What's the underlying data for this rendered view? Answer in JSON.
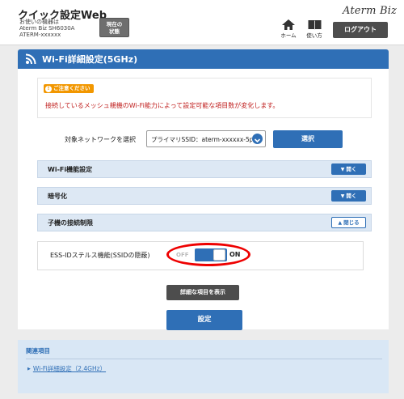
{
  "header": {
    "app_title": "クイック設定Web",
    "device_caption": "お使いの機器は",
    "device_model": "Aterm Biz SH6030A",
    "device_id": "ATERM-xxxxxx",
    "status_button": "現在の\n状態",
    "brand": "Aterm Biz",
    "nav_home": "ホーム",
    "nav_manual": "使い方",
    "logout": "ログアウト"
  },
  "page": {
    "title": "Wi-Fi詳細設定(5GHz)"
  },
  "notice": {
    "badge": "ご注意ください",
    "text": "接続しているメッシュ親機のWi-Fi能力によって設定可能な項目数が変化します。"
  },
  "network_select": {
    "label": "対象ネットワークを選択",
    "selected": "プライマリSSID：aterm-xxxxxx-5p",
    "button": "選択"
  },
  "sections": [
    {
      "label": "Wi-Fi機能設定",
      "button": "開く",
      "expanded": false
    },
    {
      "label": "暗号化",
      "button": "開く",
      "expanded": false
    },
    {
      "label": "子機の接続制限",
      "button": "閉じる",
      "expanded": true
    }
  ],
  "stealth": {
    "label": "ESS-IDステルス機能(SSIDの隠蔽)",
    "off": "OFF",
    "on": "ON",
    "state": "ON"
  },
  "buttons": {
    "show_details": "詳細な項目を表示",
    "apply": "設定"
  },
  "related": {
    "heading": "関連項目",
    "link": "Wi-Fi詳細設定（2.4GHz）"
  },
  "colors": {
    "primary": "#2f6fb6",
    "notice_badge": "#f29700",
    "notice_text": "#c0201f",
    "annotation": "#ee0000"
  }
}
